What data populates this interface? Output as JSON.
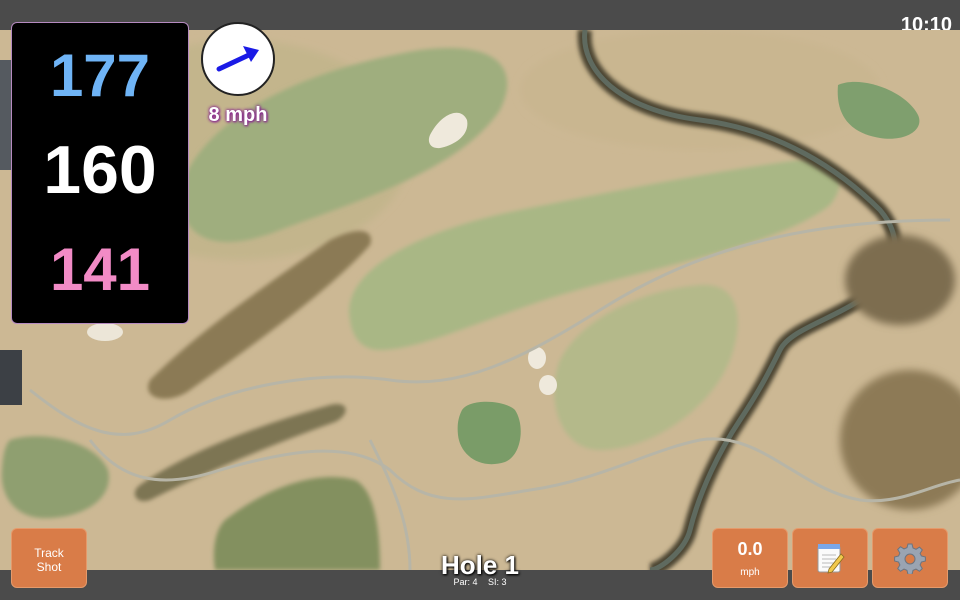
{
  "status_bar": {
    "time": "10:10"
  },
  "distances": {
    "back": "177",
    "middle": "160",
    "front": "141"
  },
  "wind": {
    "speed_label": "8 mph",
    "direction_icon": "wind-arrow-icon"
  },
  "colors": {
    "back": "#6fb4f6",
    "middle": "#ffffff",
    "front": "#f28bc6",
    "button": "#d97c48"
  },
  "buttons": {
    "track_shot": "Track\nShot",
    "wind_value": "0.0",
    "wind_unit": "mph",
    "notes_icon": "notepad-icon",
    "settings_icon": "gear-icon"
  },
  "hole": {
    "title": "Hole 1",
    "par": "Par: 4",
    "si": "SI: 3"
  }
}
